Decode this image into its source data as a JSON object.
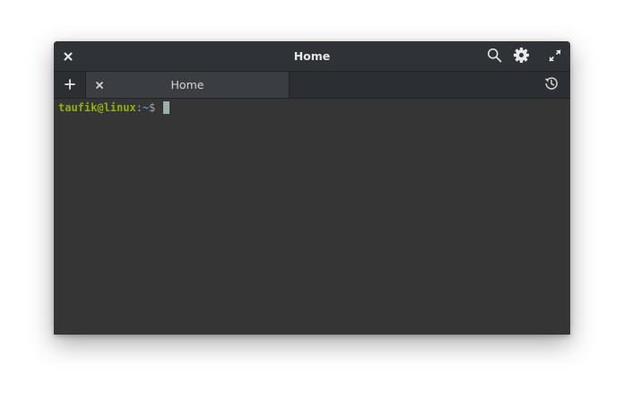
{
  "window": {
    "title": "Home"
  },
  "titlebar": {
    "close_icon": "close-icon",
    "search_icon": "search-icon",
    "settings_icon": "gear-icon",
    "maximize_icon": "maximize-icon"
  },
  "tabs": [
    {
      "label": "Home",
      "active": true
    }
  ],
  "tabbar": {
    "new_tab_icon": "plus-icon",
    "history_icon": "history-icon"
  },
  "terminal": {
    "user_host": "taufik@linux",
    "separator": ":",
    "path": "~",
    "prompt_symbol": "$ ",
    "input": ""
  },
  "colors": {
    "background": "#353535",
    "titlebar": "#2f3237",
    "user_host": "#8fae12",
    "path": "#6f9ed3",
    "cursor": "#9bb0a8"
  }
}
